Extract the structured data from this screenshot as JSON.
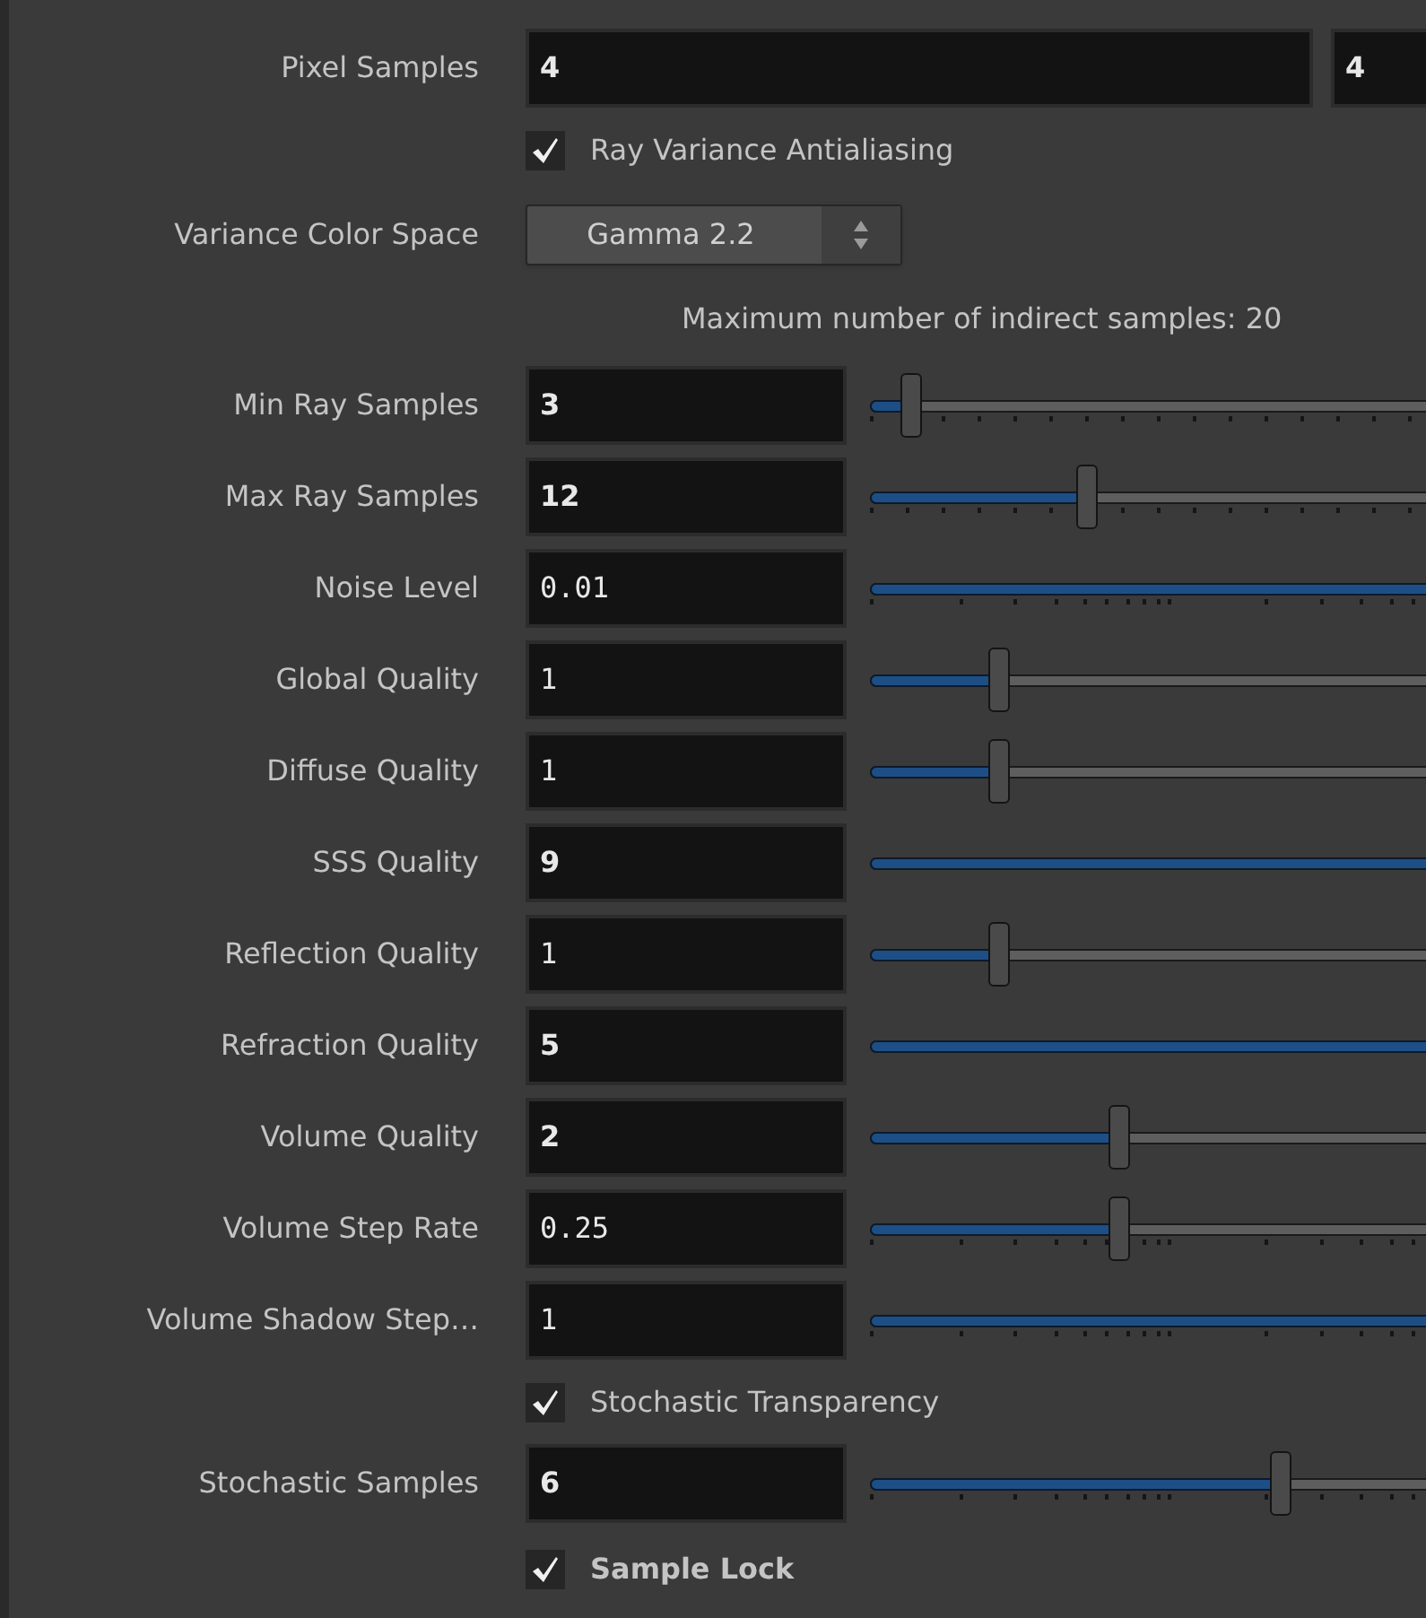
{
  "rows": [
    {
      "kind": "pair",
      "label": "Pixel Samples",
      "values": [
        {
          "value": "4",
          "modified": true
        },
        {
          "value": "4",
          "modified": true
        }
      ]
    },
    {
      "kind": "checkbox",
      "label": "Ray Variance Antialiasing",
      "checked": true,
      "modified": false
    },
    {
      "kind": "menu",
      "label": "Variance Color Space",
      "value": "Gamma 2.2"
    },
    {
      "kind": "note",
      "text": "Maximum number of indirect samples: 20"
    },
    {
      "kind": "slider",
      "label": "Min Ray Samples",
      "value": "3",
      "modified": true,
      "level": 0.04,
      "ticks": true,
      "log_scale": false
    },
    {
      "kind": "slider",
      "label": "Max Ray Samples",
      "value": "12",
      "modified": true,
      "level": 0.23,
      "ticks": true,
      "log_scale": false
    },
    {
      "kind": "slider",
      "label": "Noise Level",
      "value": "0.01",
      "modified": false,
      "ticks": true,
      "log_scale": true
    },
    {
      "kind": "slider",
      "label": "Global Quality",
      "value": "1",
      "modified": false,
      "level": 0.135,
      "ticks": false
    },
    {
      "kind": "slider",
      "label": "Diffuse Quality",
      "value": "1",
      "modified": false,
      "level": 0.135,
      "ticks": false
    },
    {
      "kind": "slider",
      "label": "SSS Quality",
      "value": "9",
      "modified": true,
      "ticks": false
    },
    {
      "kind": "slider",
      "label": "Reflection Quality",
      "value": "1",
      "modified": false,
      "level": 0.135,
      "ticks": false
    },
    {
      "kind": "slider",
      "label": "Refraction Quality",
      "value": "5",
      "modified": true,
      "ticks": false
    },
    {
      "kind": "slider",
      "label": "Volume Quality",
      "value": "2",
      "modified": true,
      "level": 0.265,
      "ticks": false
    },
    {
      "kind": "slider",
      "label": "Volume Step Rate",
      "value": "0.25",
      "modified": false,
      "level": 0.265,
      "ticks": true,
      "log_scale": true
    },
    {
      "kind": "slider",
      "label": "Volume Shadow Step…",
      "value": "1",
      "modified": false,
      "ticks": true,
      "log_scale": true
    },
    {
      "kind": "checkbox",
      "label": "Stochastic Transparency",
      "checked": true,
      "modified": false
    },
    {
      "kind": "slider",
      "label": "Stochastic Samples",
      "value": "6",
      "modified": true,
      "level": 0.44,
      "ticks": true,
      "log_scale": true
    },
    {
      "kind": "checkbox",
      "label": "Sample Lock",
      "checked": true,
      "modified": true
    }
  ]
}
